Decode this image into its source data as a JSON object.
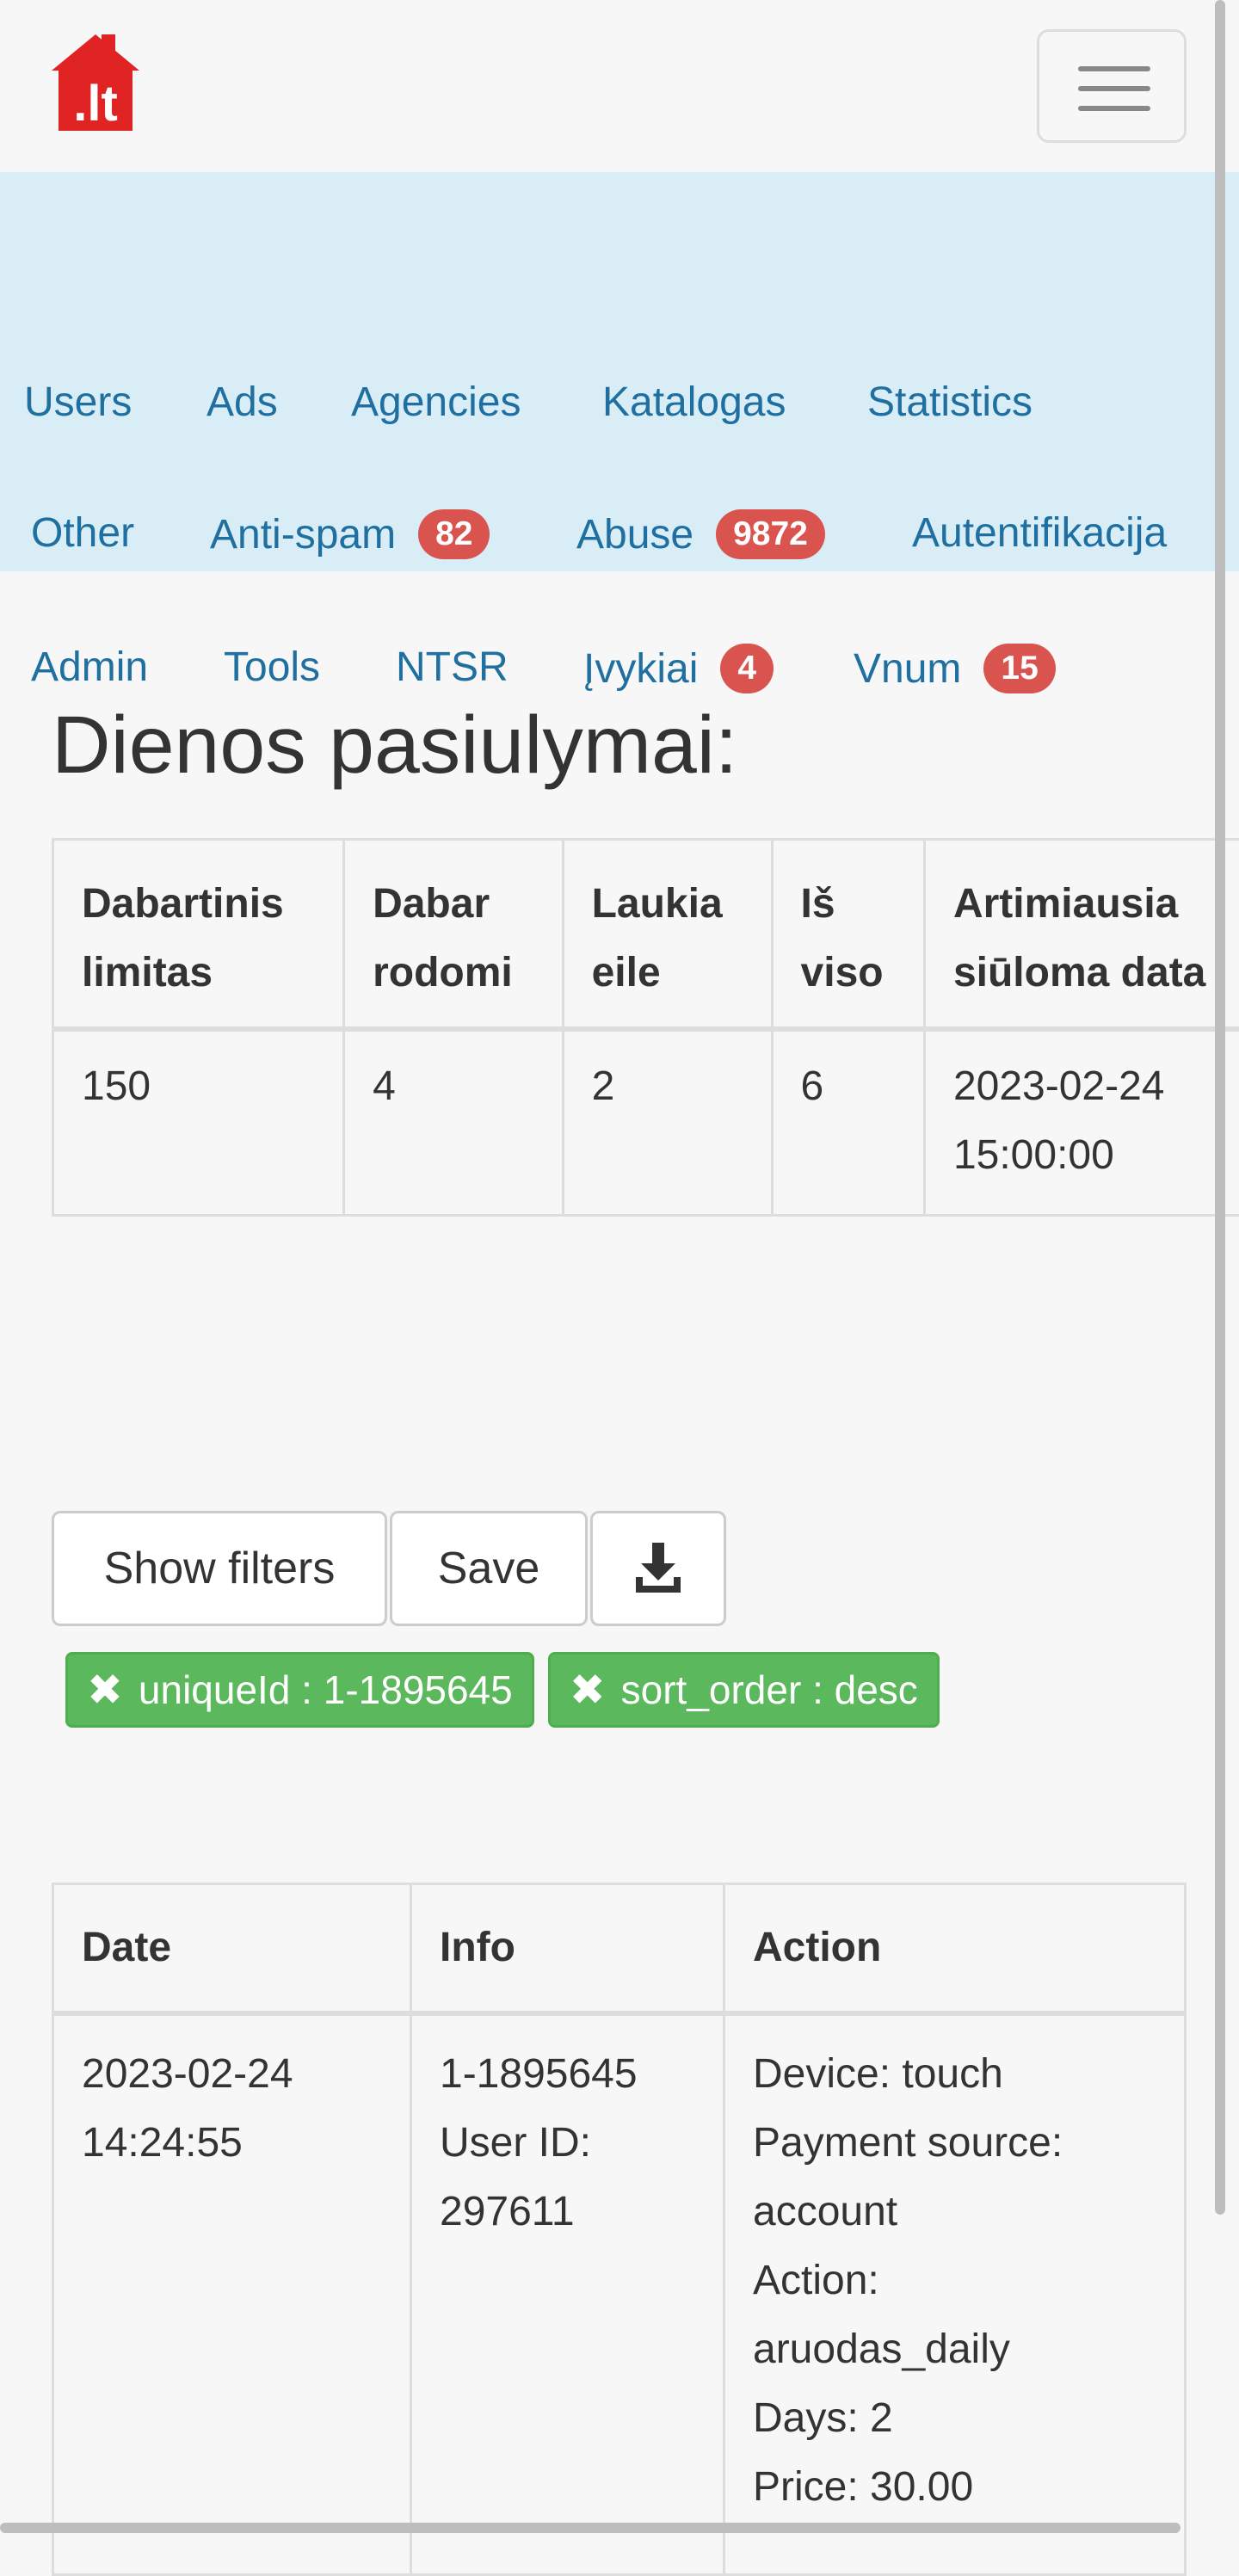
{
  "logo": {
    "text": ".lt",
    "color": "#e02424"
  },
  "nav": {
    "items": [
      {
        "label": "Users"
      },
      {
        "label": "Ads"
      },
      {
        "label": "Agencies"
      },
      {
        "label": "Katalogas"
      },
      {
        "label": "Statistics"
      },
      {
        "label": "Other"
      },
      {
        "label": "Anti-spam",
        "badge": "82"
      },
      {
        "label": "Abuse",
        "badge": "9872"
      },
      {
        "label": "Autentifikacija"
      },
      {
        "label": "Admin"
      },
      {
        "label": "Tools"
      },
      {
        "label": "NTSR"
      },
      {
        "label": "Įvykiai",
        "badge": "4"
      },
      {
        "label": "Vnum",
        "badge": "15"
      }
    ]
  },
  "page": {
    "title": "Dienos pasiulymai:"
  },
  "summary_table": {
    "headers": [
      "Dabartinis limitas",
      "Dabar rodomi",
      "Laukia eile",
      "Iš viso",
      "Artimiausia siūloma data"
    ],
    "row": [
      "150",
      "4",
      "2",
      "6",
      "2023-02-24 15:00:00"
    ]
  },
  "toolbar": {
    "show_filters": "Show filters",
    "save": "Save",
    "download_icon": "download-icon"
  },
  "filters": [
    {
      "x": "✖",
      "text": "uniqueId : 1-1895645"
    },
    {
      "x": "✖",
      "text": "sort_order : desc"
    }
  ],
  "log_table": {
    "headers": [
      "Date",
      "Info",
      "Action"
    ],
    "rows": [
      {
        "date": [
          "2023-02-24",
          "14:24:55"
        ],
        "info": [
          "1-1895645",
          "User ID:",
          "297611"
        ],
        "action": [
          "Device: touch",
          "Payment source:",
          "account",
          "Action:",
          "aruodas_daily",
          "Days: 2",
          "Price: 30.00"
        ]
      }
    ]
  },
  "colors": {
    "nav_bg": "#d9edf7",
    "link": "#1f6fa0",
    "badge": "#d9534f",
    "filter": "#5cb85c"
  }
}
